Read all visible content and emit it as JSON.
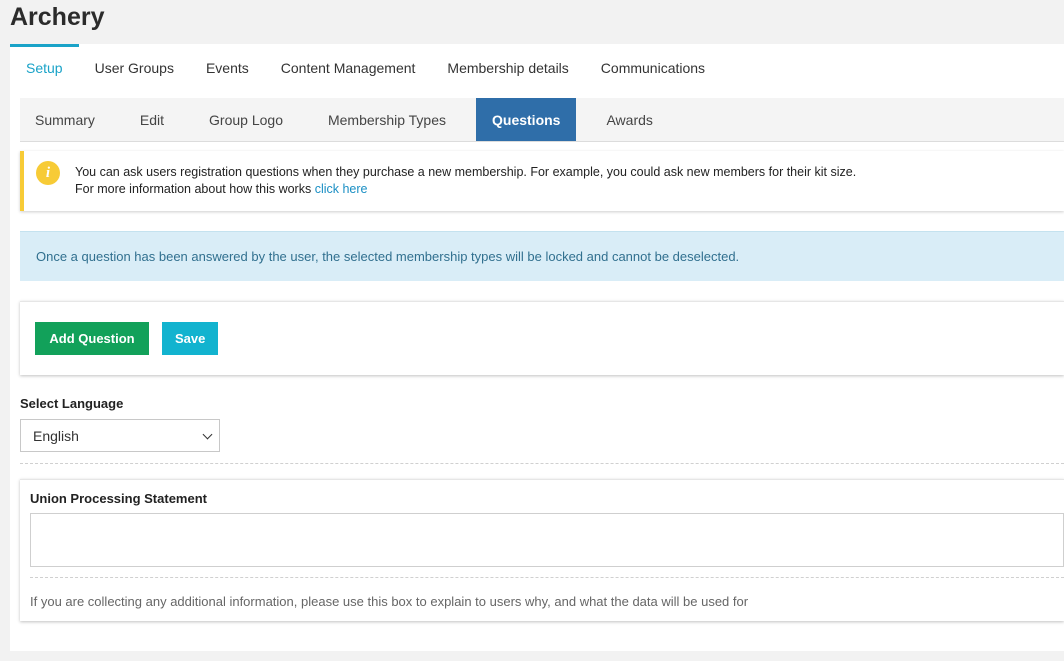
{
  "page": {
    "title": "Archery"
  },
  "top_tabs": [
    {
      "label": "Setup",
      "active": true
    },
    {
      "label": "User Groups",
      "active": false
    },
    {
      "label": "Events",
      "active": false
    },
    {
      "label": "Content Management",
      "active": false
    },
    {
      "label": "Membership details",
      "active": false
    },
    {
      "label": "Communications",
      "active": false
    }
  ],
  "sub_tabs": [
    {
      "label": "Summary",
      "active": false
    },
    {
      "label": "Edit",
      "active": false
    },
    {
      "label": "Group Logo",
      "active": false
    },
    {
      "label": "Membership Types",
      "active": false
    },
    {
      "label": "Questions",
      "active": true
    },
    {
      "label": "Awards",
      "active": false
    }
  ],
  "info": {
    "icon": "info-icon",
    "line1": "You can ask users registration questions when they purchase a new membership. For example, you could ask new members for their kit size.",
    "line2_prefix": "For more information about how this works ",
    "link_text": "click here"
  },
  "notice": {
    "text": "Once a question has been answered by the user, the selected membership types will be locked and cannot be deselected."
  },
  "actions": {
    "add_label": "Add Question",
    "save_label": "Save"
  },
  "language": {
    "label": "Select Language",
    "selected": "English"
  },
  "statement": {
    "label": "Union Processing Statement",
    "value": "",
    "help": "If you are collecting any additional information, please use this box to explain to users why, and what the data will be used for"
  },
  "colors": {
    "accent": "#1aa3c8",
    "active_subtab": "#2f6ea9",
    "add_button": "#12a15a",
    "save_button": "#12b3cf",
    "warning": "#f7cb36",
    "notice_bg": "#d9edf7"
  }
}
